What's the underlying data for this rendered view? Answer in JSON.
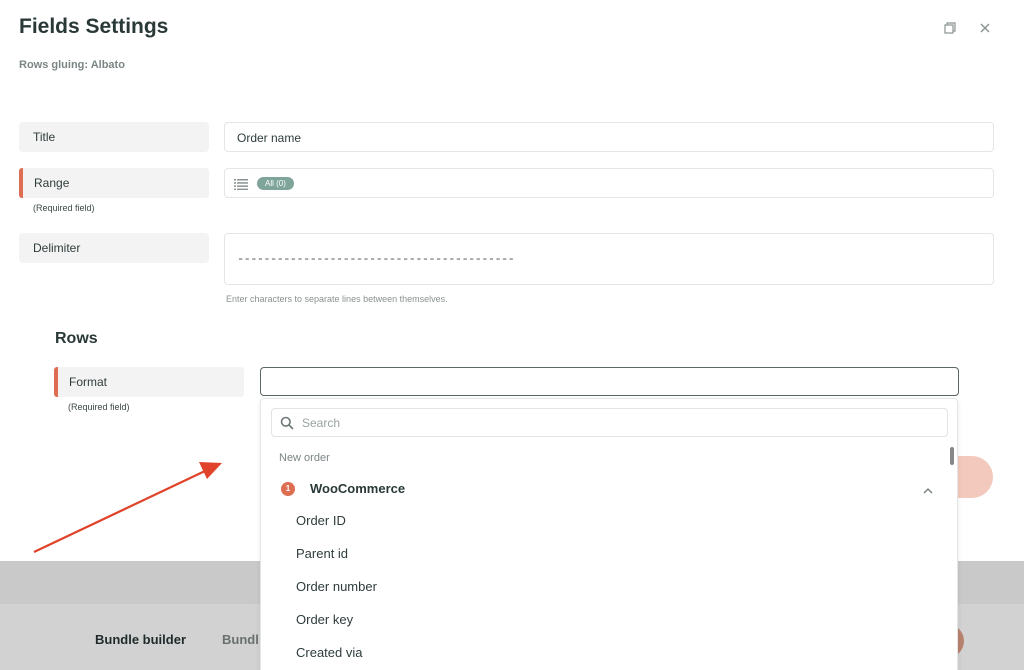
{
  "modal": {
    "title": "Fields Settings",
    "subtitle": "Rows gluing: Albato",
    "restore_icon": "restore-window-icon",
    "close_icon": "close-icon"
  },
  "form": {
    "title_label": "Title",
    "title_value": "Order name",
    "range_label": "Range",
    "range_required": "(Required field)",
    "range_chip": "All (0)",
    "range_icon": "list-icon",
    "delimiter_label": "Delimiter",
    "delimiter_value": "------------------------------------------",
    "delimiter_help": "Enter characters to separate lines between themselves."
  },
  "rows": {
    "heading": "Rows",
    "format_label": "Format",
    "format_required": "(Required field)",
    "format_value": ""
  },
  "dropdown": {
    "search_placeholder": "Search",
    "search_icon": "search-icon",
    "group_label": "New order",
    "app_badge": "1",
    "app_name": "WooCommerce",
    "collapse_icon": "chevron-up-icon",
    "options": [
      "Order ID",
      "Parent id",
      "Order number",
      "Order key",
      "Created via"
    ]
  },
  "bottom": {
    "item1": "Bundle builder",
    "item2": "Bundl"
  },
  "colors": {
    "accent": "#dd6e52",
    "chip": "#7fa59b",
    "arrow": "#e0432a"
  }
}
